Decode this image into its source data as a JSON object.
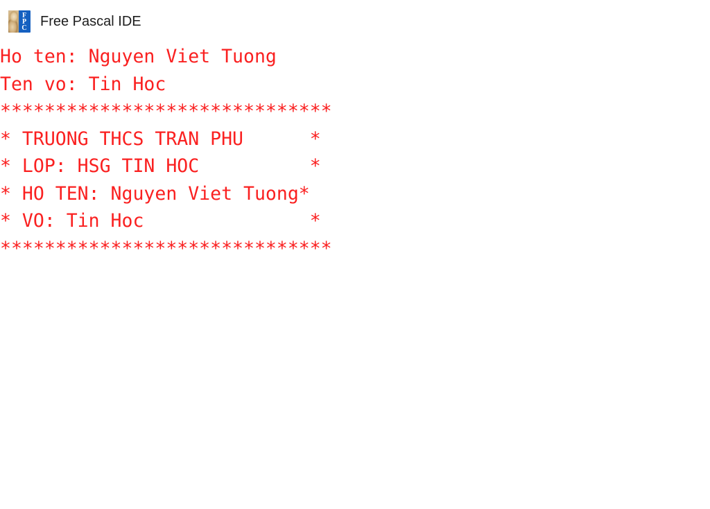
{
  "window": {
    "title": "Free Pascal IDE",
    "icon": "fpc-logo-icon",
    "icon_letters": [
      "F",
      "P",
      "C"
    ],
    "background_color": "#ffffff",
    "title_color": "#1d1d1d"
  },
  "console": {
    "text_color": "#fa2020",
    "font": "monospace",
    "box_width_chars": 30,
    "lines": [
      "Ho ten: Nguyen Viet Tuong",
      "Ten vo: Tin Hoc",
      "******************************",
      "* TRUONG THCS TRAN PHU      *",
      "* LOP: HSG TIN HOC          *",
      "* HO TEN: Nguyen Viet Tuong*",
      "* VO: Tin Hoc               *",
      "******************************"
    ]
  }
}
